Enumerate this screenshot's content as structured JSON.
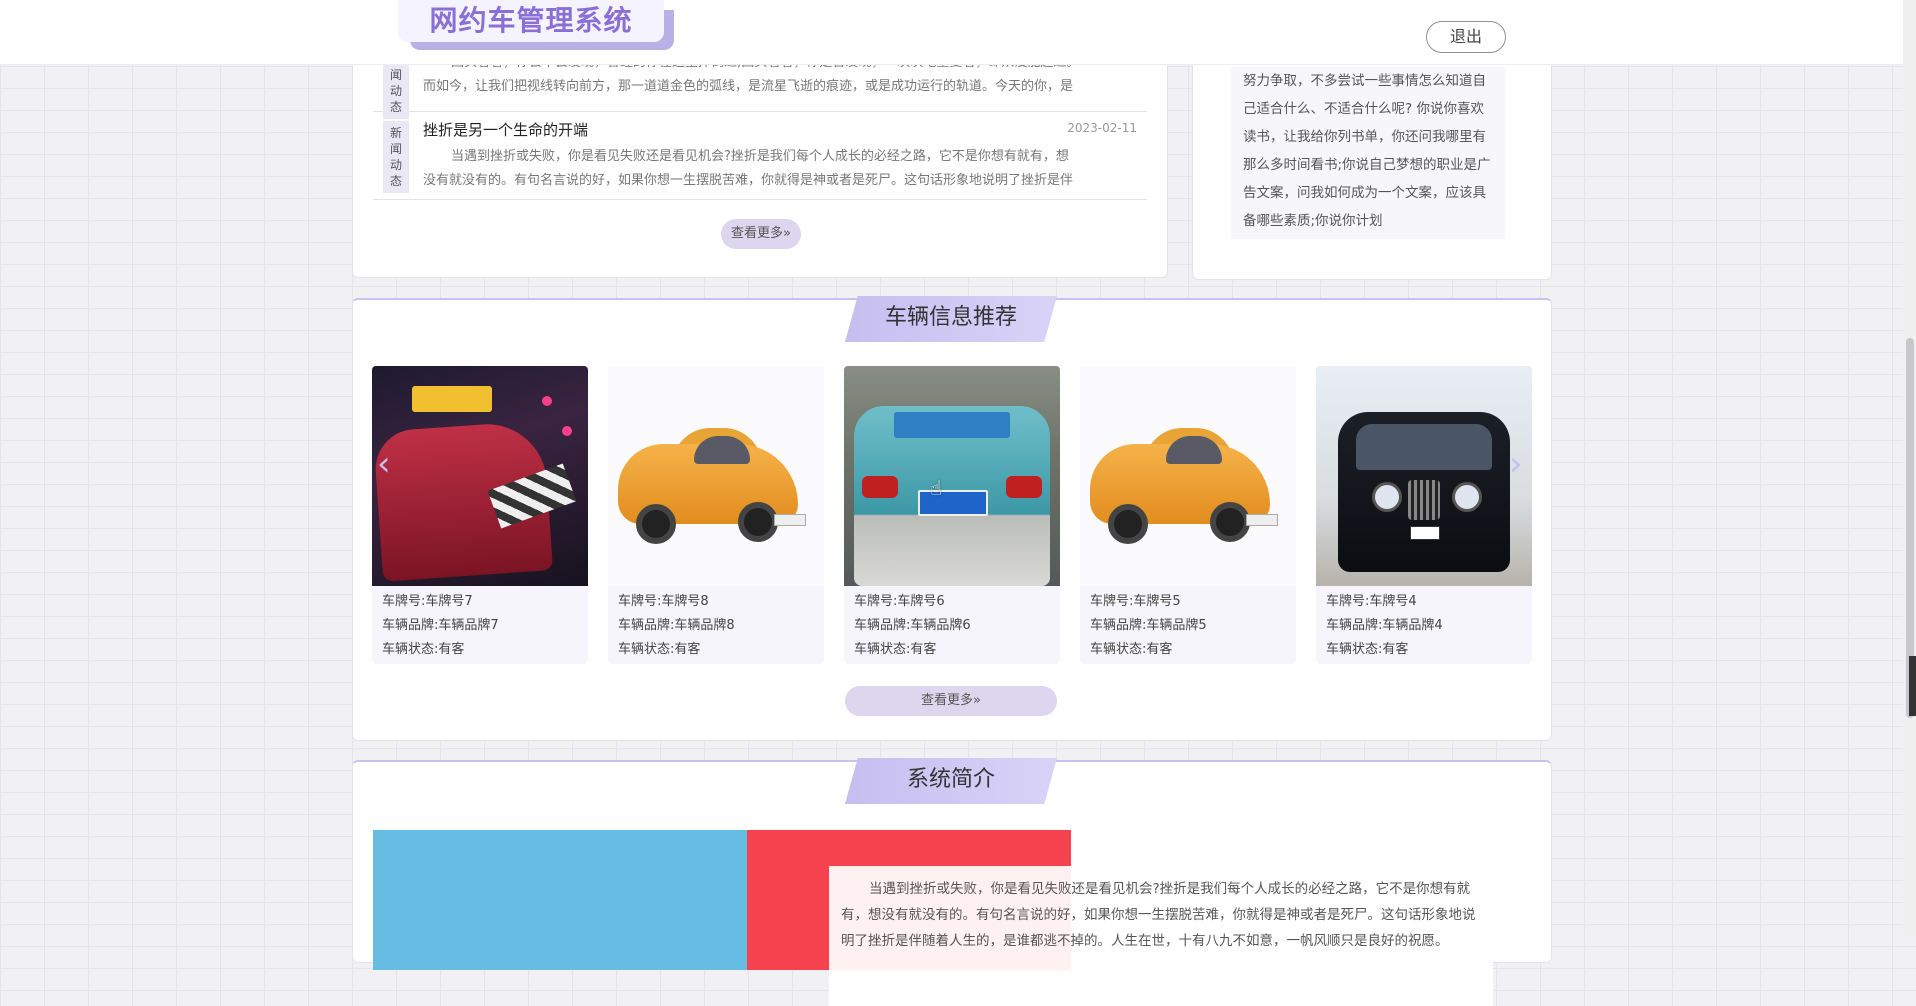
{
  "header": {
    "logo_text": "网约车管理系统",
    "logout_label": "退出"
  },
  "news": {
    "items": [
      {
        "tag": "新闻动态",
        "title": "",
        "date": "",
        "body_lines": [
          "回头看看，你会不会发现，曾经的你在这里摔倒过;回头看看，你是否发现，一次次地重复着，却从没能超过。",
          "而如今，让我们把视线转向前方，那一道道金色的弧线，是流星飞逝的痕迹，或是成功运行的轨道。今天的你，是"
        ]
      },
      {
        "tag": "新闻动态",
        "title": "挫折是另一个生命的开端",
        "date": "2023-02-11",
        "body_lines": [
          "当遇到挫折或失败，你是看见失败还是看见机会?挫折是我们每个人成长的必经之路，它不是你想有就有，想",
          "没有就没有的。有句名言说的好，如果你想一生摆脱苦难，你就得是神或者是死尸。这句话形象地说明了挫折是伴"
        ]
      }
    ],
    "more_label": "查看更多»"
  },
  "side": {
    "text": "努力争取，不多尝试一些事情怎么知道自己适合什么、不适合什么呢? 你说你喜欢读书，让我给你列书单，你还问我哪里有那么多时间看书;你说自己梦想的职业是广告文案，问我如何成为一个文案，应该具备哪些素质;你说你计划"
  },
  "vehicles": {
    "title": "车辆信息推荐",
    "more_label": "查看更多»",
    "cards": [
      {
        "plate": "车牌号:车牌号7",
        "brand": "车辆品牌:车辆品牌7",
        "status": "车辆状态:有客",
        "image": "night-taxi"
      },
      {
        "plate": "车牌号:车牌号8",
        "brand": "车辆品牌:车辆品牌8",
        "status": "车辆状态:有客",
        "image": "cartoon-taxi"
      },
      {
        "plate": "车牌号:车牌号6",
        "brand": "车辆品牌:车辆品牌6",
        "status": "车辆状态:有客",
        "image": "teal-taxi"
      },
      {
        "plate": "车牌号:车牌号5",
        "brand": "车辆品牌:车辆品牌5",
        "status": "车辆状态:有客",
        "image": "cartoon-taxi"
      },
      {
        "plate": "车牌号:车牌号4",
        "brand": "车辆品牌:车辆品牌4",
        "status": "车辆状态:有客",
        "image": "black-cab"
      }
    ]
  },
  "intro": {
    "title": "系统简介",
    "text": "当遇到挫折或失败，你是看见失败还是看见机会?挫折是我们每个人成长的必经之路，它不是你想有就有，想没有就没有的。有句名言说的好，如果你想一生摆脱苦难，你就得是神或者是死尸。这句话形象地说明了挫折是伴随着人生的，是谁都逃不掉的。人生在世，十有八九不如意，一帆风顺只是良好的祝愿。"
  },
  "icons": {
    "prev": "chevron-left-icon",
    "next": "chevron-right-icon",
    "cursor": "hand-cursor-icon"
  },
  "colors": {
    "accent": "#8a6fd6",
    "section_title_bg": "#c6bef0",
    "button_bg": "#dcd7ef"
  }
}
